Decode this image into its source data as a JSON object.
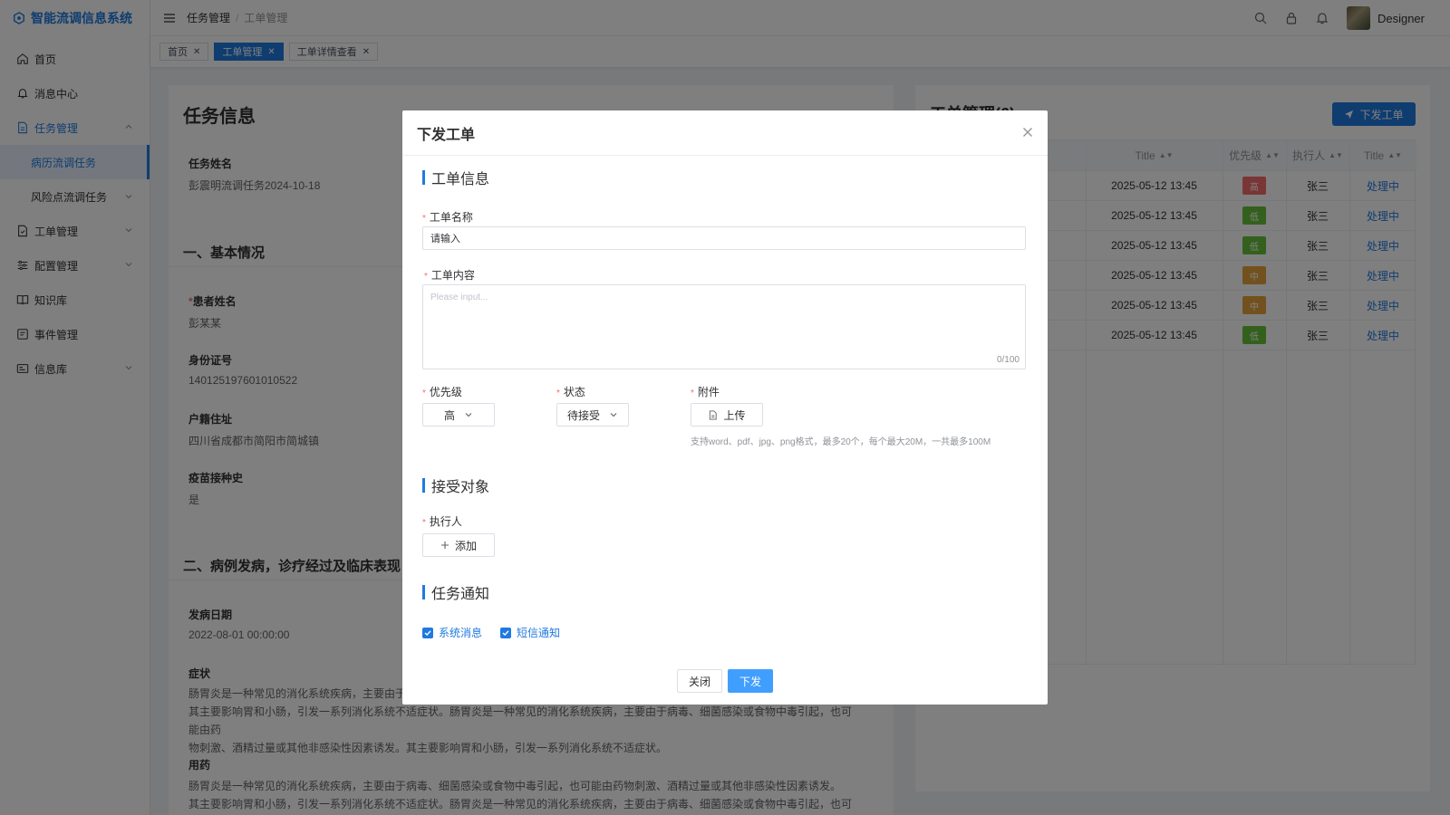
{
  "app": {
    "title": "智能流调信息系统"
  },
  "sidebar": {
    "items": [
      {
        "label": "首页",
        "icon": "home-icon"
      },
      {
        "label": "消息中心",
        "icon": "bell-icon"
      },
      {
        "label": "任务管理",
        "icon": "document-icon"
      },
      {
        "label": "病历流调任务"
      },
      {
        "label": "风险点流调任务"
      },
      {
        "label": "工单管理",
        "icon": "order-icon"
      },
      {
        "label": "配置管理",
        "icon": "sliders-icon"
      },
      {
        "label": "知识库",
        "icon": "book-icon"
      },
      {
        "label": "事件管理",
        "icon": "event-icon"
      },
      {
        "label": "信息库",
        "icon": "database-icon"
      }
    ]
  },
  "header": {
    "breadcrumb": [
      "任务管理",
      "工单管理"
    ],
    "separator": "/",
    "user": "Designer"
  },
  "tabs": [
    {
      "label": "首页",
      "active": false
    },
    {
      "label": "工单管理",
      "active": true
    },
    {
      "label": "工单详情查看",
      "active": false
    }
  ],
  "task": {
    "title": "任务信息",
    "name_label": "任务姓名",
    "name_value": "彭震明流调任务2024-10-18",
    "section1": "一、基本情况",
    "patient_label": "患者姓名",
    "patient_value": "彭某某",
    "id_label": "身份证号",
    "id_value": "140125197601010522",
    "address_label": "户籍住址",
    "address_value": "四川省成都市简阳市简城镇",
    "vaccine_label": "疫苗接种史",
    "vaccine_value": "是",
    "section2": "二、病例发病，诊疗经过及临床表现",
    "onset_label": "发病日期",
    "onset_value": "2022-08-01 00:00:00",
    "symptom_label": "症状",
    "symptom_p1": "肠胃炎是一种常见的消化系统疾病，主要由于",
    "symptom_p2": "其主要影响胃和小肠，引发一系列消化系统不适症状。肠胃炎是一种常见的消化系统疾病，主要由于病毒、细菌感染或食物中毒引起，也可能由药",
    "symptom_p3": "物刺激、酒精过量或其他非感染性因素诱发。其主要影响胃和小肠，引发一系列消化系统不适症状。",
    "med_label": "用药",
    "med_p1": "肠胃炎是一种常见的消化系统疾病，主要由于病毒、细菌感染或食物中毒引起，也可能由药物刺激、酒精过量或其他非感染性因素诱发。",
    "med_p2": "其主要影响胃和小肠，引发一系列消化系统不适症状。肠胃炎是一种常见的消化系统疾病，主要由于病毒、细菌感染或食物中毒引起，也可能由药"
  },
  "orders": {
    "title": "工单管理(6)",
    "send_button": "下发工单",
    "columns": [
      "Title",
      "优先级",
      "执行人",
      "Title"
    ],
    "rows": [
      {
        "time": "2025-05-12 13:45",
        "priority": "高",
        "color": "#f56c6c",
        "assignee": "张三",
        "status": "处理中"
      },
      {
        "time": "2025-05-12 13:45",
        "priority": "低",
        "color": "#67c23a",
        "assignee": "张三",
        "status": "处理中"
      },
      {
        "time": "2025-05-12 13:45",
        "priority": "低",
        "color": "#67c23a",
        "assignee": "张三",
        "status": "处理中"
      },
      {
        "time": "2025-05-12 13:45",
        "priority": "中",
        "color": "#e6a23c",
        "assignee": "张三",
        "status": "处理中"
      },
      {
        "time": "2025-05-12 13:45",
        "priority": "中",
        "color": "#e6a23c",
        "assignee": "张三",
        "status": "处理中"
      },
      {
        "time": "2025-05-12 13:45",
        "priority": "低",
        "color": "#67c23a",
        "assignee": "张三",
        "status": "处理中"
      }
    ]
  },
  "dialog": {
    "title": "下发工单",
    "section_info": "工单信息",
    "name_label": "工单名称",
    "name_value": "请输入",
    "content_label": "工单内容",
    "content_placeholder": "Please input...",
    "content_count": "0/100",
    "priority_label": "优先级",
    "priority_value": "高",
    "status_label": "状态",
    "status_value": "待接受",
    "attach_label": "附件",
    "upload_label": "上传",
    "upload_hint": "支持word、pdf、jpg、png格式，最多20个，每个最大20M，一共最多100M",
    "section_receiver": "接受对象",
    "executor_label": "执行人",
    "add_label": "添加",
    "section_notify": "任务通知",
    "notify_system": "系统消息",
    "notify_sms": "短信通知",
    "close_button": "关闭",
    "submit_button": "下发",
    "required_mark": "*"
  },
  "colors": {
    "accent": "#1f7ae0",
    "danger": "#f56c6c",
    "success": "#67c23a",
    "warning": "#e6a23c"
  }
}
